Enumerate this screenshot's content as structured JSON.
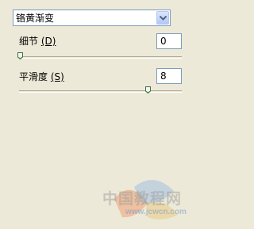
{
  "dropdown": {
    "selected": "铬黄渐变"
  },
  "params": [
    {
      "label": "细节",
      "accel": "(D)",
      "value": "0",
      "slider_fraction": 0.0
    },
    {
      "label": "平滑度",
      "accel": "(S)",
      "value": "8",
      "slider_fraction": 0.8
    }
  ],
  "watermark": {
    "text": "中国教程网",
    "url": "www.jcwcn.com"
  },
  "colors": {
    "background": "#ece9d8",
    "input_border": "#7f9db9",
    "thumb_accent": "#21a121"
  }
}
